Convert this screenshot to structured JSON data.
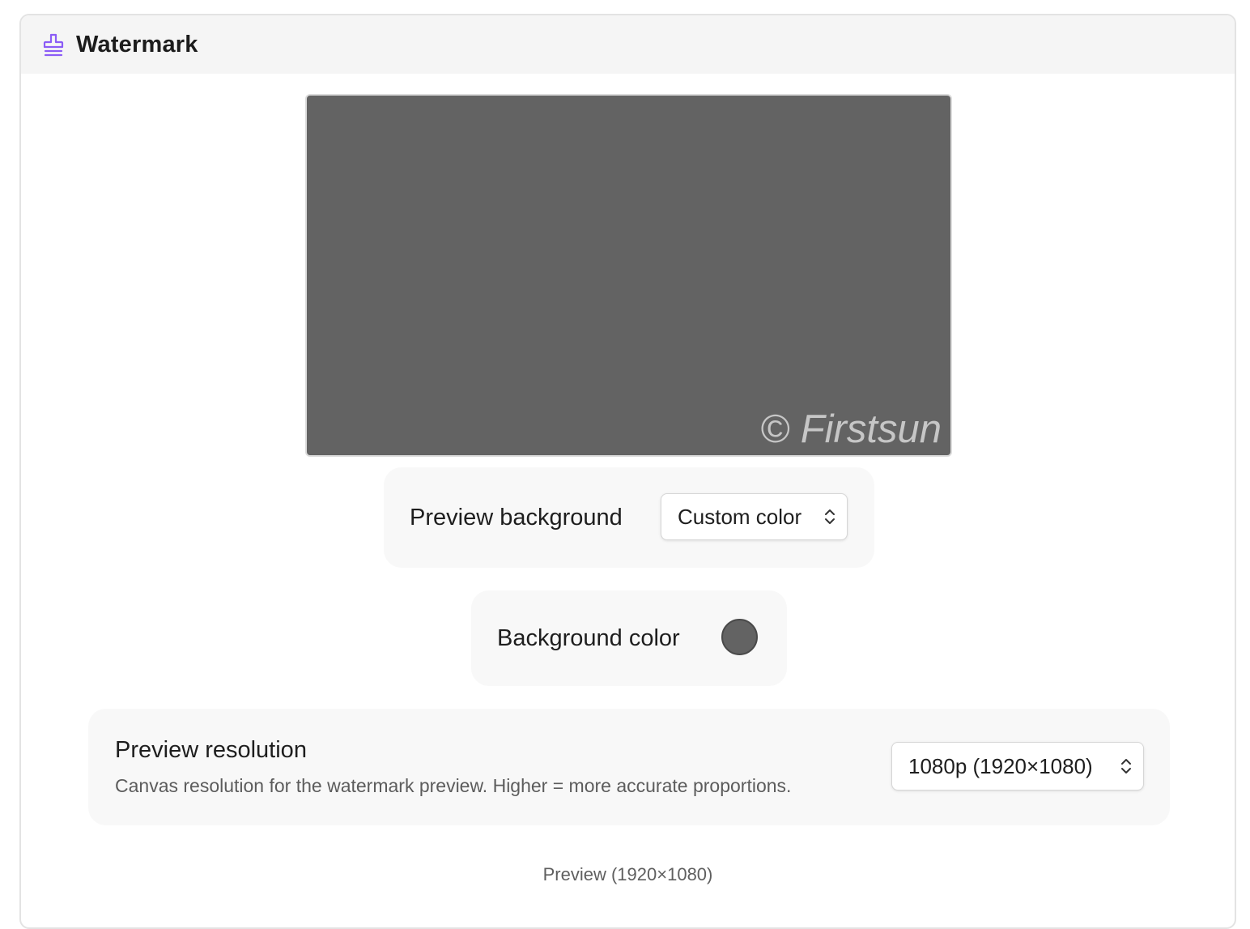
{
  "section": {
    "title": "Watermark",
    "icon": "stamp-icon",
    "accent_color": "#8b5cf6"
  },
  "preview": {
    "background_color": "#636363",
    "watermark_text": "© Firstsun",
    "caption": "Preview (1920×1080)"
  },
  "preview_background": {
    "label": "Preview background",
    "selected": "Custom color"
  },
  "background_color": {
    "label": "Background color",
    "value": "#636363"
  },
  "preview_resolution": {
    "label": "Preview resolution",
    "description": "Canvas resolution for the watermark preview. Higher = more accurate proportions.",
    "selected": "1080p (1920×1080)"
  }
}
